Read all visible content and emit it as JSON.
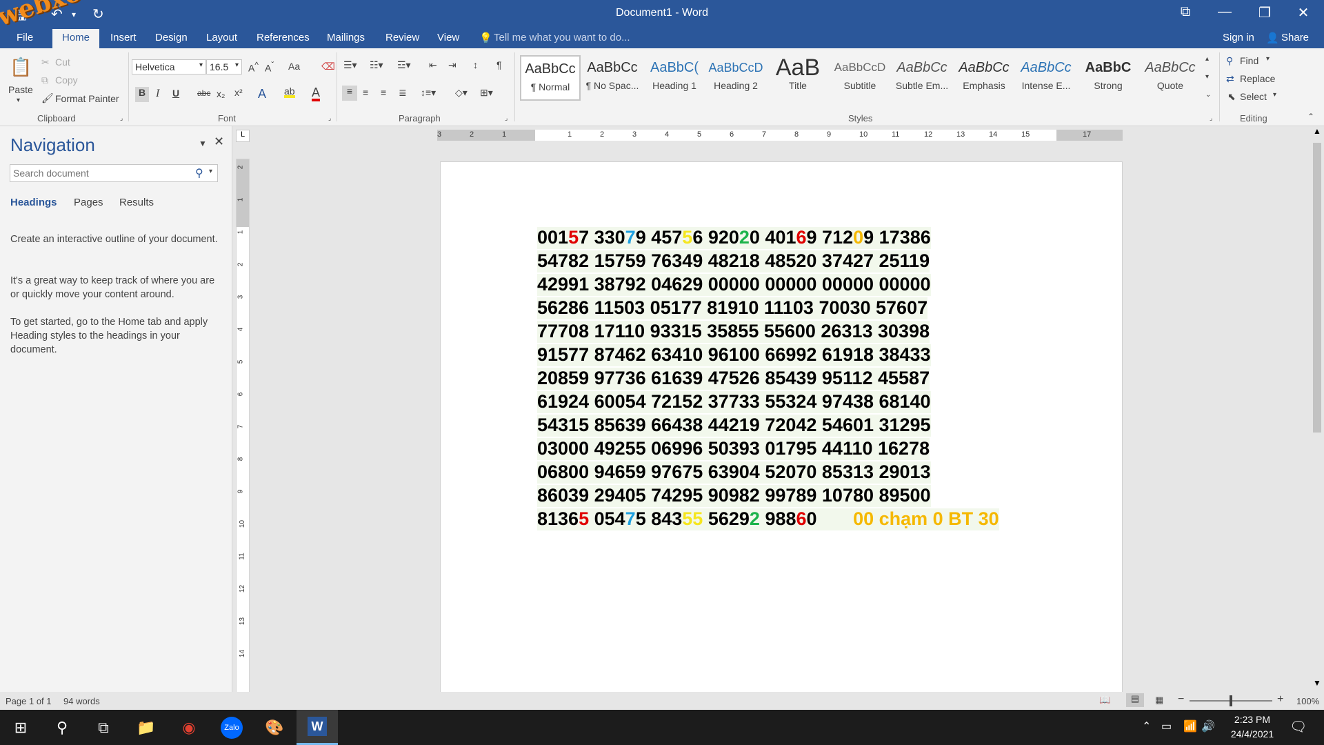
{
  "titlebar": {
    "title": "Document1 - Word",
    "restore_icon": "ribbon-display-icon",
    "min_glyph": "—",
    "max_glyph": "❐",
    "close_glyph": "✕"
  },
  "watermark": "webxoso.net",
  "tabs": [
    "File",
    "Home",
    "Insert",
    "Design",
    "Layout",
    "References",
    "Mailings",
    "Review",
    "View"
  ],
  "tell_me": "Tell me what you want to do...",
  "sign_in": "Sign in",
  "share": "Share",
  "clipboard": {
    "paste": "Paste",
    "cut": "Cut",
    "copy": "Copy",
    "format_painter": "Format Painter",
    "group": "Clipboard"
  },
  "font": {
    "name": "Helvetica",
    "size": "16.5",
    "group": "Font",
    "change_case": "Aa",
    "bold": "B",
    "italic": "I",
    "underline": "U",
    "strike": "abc"
  },
  "paragraph": {
    "group": "Paragraph",
    "pilcrow": "¶"
  },
  "styles": {
    "group": "Styles",
    "items": [
      {
        "preview": "AaBbCc",
        "name": "¶ Normal"
      },
      {
        "preview": "AaBbCc",
        "name": "¶ No Spac..."
      },
      {
        "preview": "AaBbC(",
        "name": "Heading 1"
      },
      {
        "preview": "AaBbCcD",
        "name": "Heading 2"
      },
      {
        "preview": "AaB",
        "name": "Title"
      },
      {
        "preview": "AaBbCcD",
        "name": "Subtitle"
      },
      {
        "preview": "AaBbCc",
        "name": "Subtle Em..."
      },
      {
        "preview": "AaBbCc",
        "name": "Emphasis"
      },
      {
        "preview": "AaBbCc",
        "name": "Intense E..."
      },
      {
        "preview": "AaBbC",
        "name": "Strong"
      },
      {
        "preview": "AaBbCc",
        "name": "Quote"
      }
    ]
  },
  "editing": {
    "find": "Find",
    "replace": "Replace",
    "select": "Select",
    "group": "Editing"
  },
  "navigation": {
    "title": "Navigation",
    "search_placeholder": "Search document",
    "tabs": [
      "Headings",
      "Pages",
      "Results"
    ],
    "help": [
      "Create an interactive outline of your document.",
      "It's a great way to keep track of where you are or quickly move your content around.",
      "To get started, go to the Home tab and apply Heading styles to the headings in your document."
    ]
  },
  "ruler": {
    "h_ticks": [
      "3",
      "2",
      "1",
      "1",
      "2",
      "3",
      "4",
      "5",
      "6",
      "7",
      "8",
      "9",
      "10",
      "11",
      "12",
      "13",
      "14",
      "15",
      "17"
    ],
    "v_ticks": [
      "2",
      "1",
      "1",
      "2",
      "3",
      "4",
      "5",
      "6",
      "7",
      "8",
      "9",
      "10",
      "11",
      "12",
      "13",
      "14"
    ]
  },
  "document": {
    "rows": [
      [
        {
          "t": "001"
        },
        {
          "t": "5",
          "c": "#e00000"
        },
        {
          "t": "7 330"
        },
        {
          "t": "7",
          "c": "#1ea0e0"
        },
        {
          "t": "9 457"
        },
        {
          "t": "5",
          "c": "#f5e61e"
        },
        {
          "t": "6 920"
        },
        {
          "t": "2",
          "c": "#1bb34a"
        },
        {
          "t": "0 401"
        },
        {
          "t": "6",
          "c": "#e00000"
        },
        {
          "t": "9 712"
        },
        {
          "t": "0",
          "c": "#f5b800"
        },
        {
          "t": "9 17386"
        }
      ],
      [
        {
          "t": "54782 15759 76349 48218 48520 37427 25119"
        }
      ],
      [
        {
          "t": "42991 38792 04629 00000 00000 00000 00000"
        }
      ],
      [
        {
          "t": "56286 11503 05177 81910 11103 70030 57607"
        }
      ],
      [
        {
          "t": "77708 17110 93315 35855 55600 26313 30398"
        }
      ],
      [
        {
          "t": "91577 87462 63410 96100 66992 61918 38433"
        }
      ],
      [
        {
          "t": "20859 97736 61639 47526 85439 95112 45587"
        }
      ],
      [
        {
          "t": "61924 60054 72152 37733 55324 97438 68140"
        }
      ],
      [
        {
          "t": "54315 85639 66438 44219 72042 54601 31295"
        }
      ],
      [
        {
          "t": "03000 49255 06996 50393 01795 44110 16278"
        }
      ],
      [
        {
          "t": "06800 94659 97675 63904 52070 85313 29013"
        }
      ],
      [
        {
          "t": "86039 29405 74295 90982 99789 10780 89500"
        }
      ],
      [
        {
          "t": "8136"
        },
        {
          "t": "5",
          "c": "#e00000"
        },
        {
          "t": " 054"
        },
        {
          "t": "7",
          "c": "#1ea0e0"
        },
        {
          "t": "5 843"
        },
        {
          "t": "55",
          "c": "#f5e61e"
        },
        {
          "t": " 5629"
        },
        {
          "t": "2",
          "c": "#1bb34a"
        },
        {
          "t": " 988"
        },
        {
          "t": "6",
          "c": "#e00000"
        },
        {
          "t": "0       "
        },
        {
          "t": "00 chạm 0 BT 30",
          "c": "#f5b800"
        }
      ]
    ]
  },
  "status": {
    "page": "Page 1 of 1",
    "words": "94 words",
    "zoom": "100%",
    "zoom_level": 0.5
  },
  "clock": {
    "time": "2:23 PM",
    "date": "24/4/2021"
  },
  "colors": {
    "brand": "#2b579a",
    "red": "#e00000",
    "blue": "#1ea0e0",
    "yellow": "#f5e61e",
    "green": "#1bb34a",
    "orange": "#f5b800"
  }
}
